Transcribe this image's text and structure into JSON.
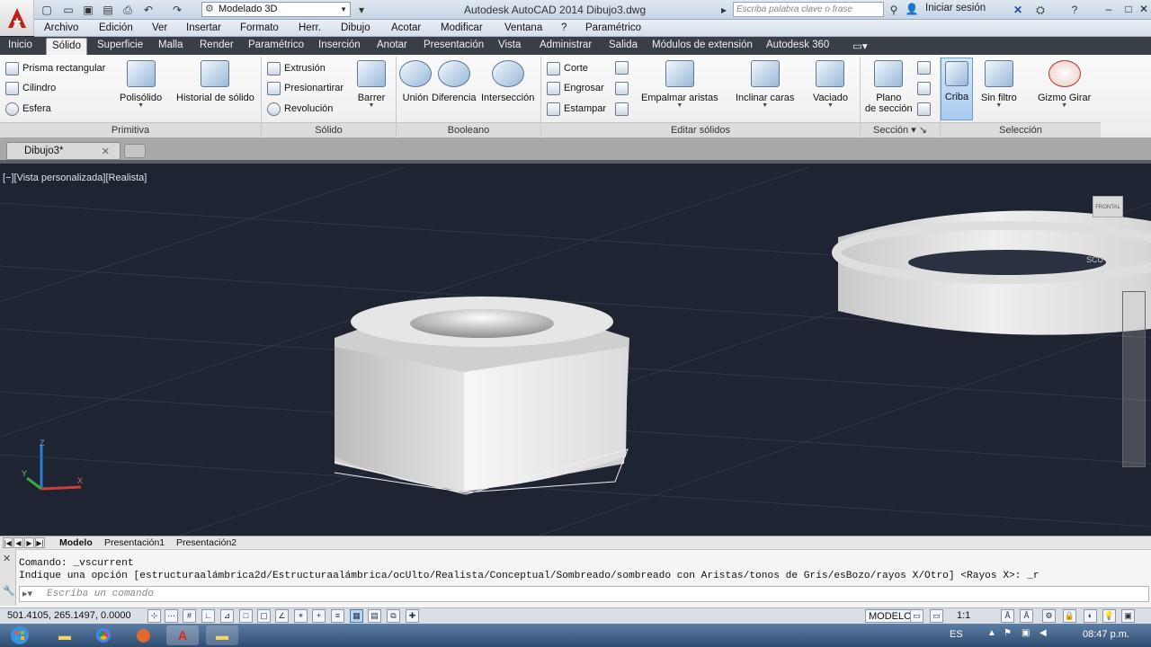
{
  "title_bar": {
    "app_title": "Autodesk AutoCAD 2014    Dibujo3.dwg",
    "workspace": "Modelado 3D",
    "search_placeholder": "Escriba palabra clave o frase",
    "signin": "Iniciar sesión",
    "quick_access_icons": [
      "new-icon",
      "open-icon",
      "save-icon",
      "save-as-icon",
      "print-icon",
      "undo-icon",
      "redo-icon"
    ]
  },
  "menu_bar": [
    "Archivo",
    "Edición",
    "Ver",
    "Insertar",
    "Formato",
    "Herr.",
    "Dibujo",
    "Acotar",
    "Modificar",
    "Ventana",
    "?",
    "Paramétrico"
  ],
  "ribbon_tabs": [
    "Inicio",
    "Sólido",
    "Superficie",
    "Malla",
    "Render",
    "Paramétrico",
    "Inserción",
    "Anotar",
    "Presentación",
    "Vista",
    "Administrar",
    "Salida",
    "Módulos de extensión",
    "Autodesk 360"
  ],
  "active_ribbon_tab": "Sólido",
  "ribbon": {
    "primitiva": {
      "label": "Primitiva",
      "small": [
        "Prisma rectangular",
        "Cilindro",
        "Esfera"
      ],
      "big": [
        "Polisólido",
        "Historial de sólido"
      ]
    },
    "solido": {
      "label": "Sólido",
      "small": [
        "Extrusión",
        "Presionartirar",
        "Revolución"
      ],
      "big": [
        "Barrer"
      ]
    },
    "booleano": {
      "label": "Booleano",
      "big": [
        "Unión",
        "Diferencia",
        "Intersección"
      ]
    },
    "editar": {
      "label": "Editar sólidos",
      "small": [
        "Corte",
        "Engrosar",
        "Estampar"
      ],
      "big": [
        "Empalmar aristas",
        "Inclinar caras",
        "Vaciado"
      ]
    },
    "seccion": {
      "label": "Sección",
      "big1": "Plano",
      "big2": "de sección"
    },
    "seleccion": {
      "label": "Selección",
      "big": [
        "Criba",
        "Sin filtro",
        "Gizmo Girar"
      ]
    }
  },
  "doc_tab": "Dibujo3*",
  "viewport_label": "[−][Vista personalizada][Realista]",
  "viewcube": {
    "face": "FRONTAL",
    "ucs": "SCU"
  },
  "layout_tabs": [
    "Modelo",
    "Presentación1",
    "Presentación2"
  ],
  "command": {
    "history": [
      "Comando: _vscurrent",
      "Indique una opción [estructuraalámbrica2d/Estructuraalámbrica/ocUlto/Realista/Conceptual/Sombreado/sombreado con Aristas/tonos de Gris/esBozo/rayos X/Otro] <Rayos X>: _r"
    ],
    "placeholder": "Escriba un comando"
  },
  "status": {
    "coords": "501.4105, 265.1497, 0.0000",
    "space": "MODELO",
    "scale": "1:1"
  },
  "taskbar": {
    "lang": "ES",
    "time": "08:47 p.m."
  },
  "colors": {
    "ribbon_tab_bg": "#3a3f47",
    "viewport_bg": "#1e2431",
    "accent": "#c41e12"
  }
}
